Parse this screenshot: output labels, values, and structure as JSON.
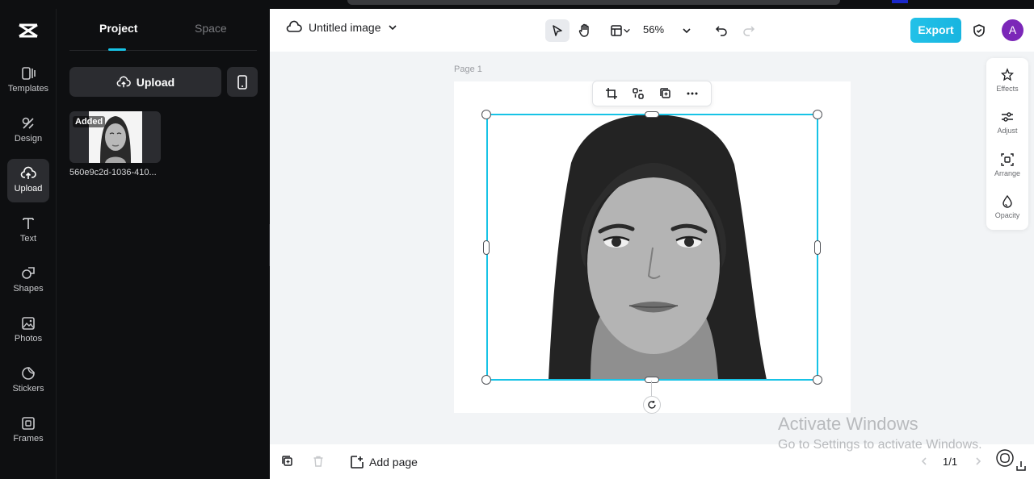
{
  "rail": {
    "items": [
      {
        "label": "Templates",
        "icon": "templates-icon"
      },
      {
        "label": "Design",
        "icon": "design-icon"
      },
      {
        "label": "Upload",
        "icon": "upload-cloud-icon"
      },
      {
        "label": "Text",
        "icon": "text-icon"
      },
      {
        "label": "Shapes",
        "icon": "shapes-icon"
      },
      {
        "label": "Photos",
        "icon": "photos-icon"
      },
      {
        "label": "Stickers",
        "icon": "stickers-icon"
      },
      {
        "label": "Frames",
        "icon": "frames-icon"
      }
    ],
    "active": "Upload"
  },
  "panel": {
    "tabs": [
      "Project",
      "Space"
    ],
    "active_tab": "Project",
    "upload_label": "Upload",
    "asset": {
      "badge": "Added",
      "filename": "560e9c2d-1036-410..."
    }
  },
  "topbar": {
    "doc_title": "Untitled image",
    "zoom": "56%",
    "export_label": "Export",
    "avatar_letter": "A"
  },
  "canvas": {
    "page_label": "Page 1"
  },
  "right_dock": {
    "items": [
      "Effects",
      "Adjust",
      "Arrange",
      "Opacity"
    ]
  },
  "bottombar": {
    "add_page_label": "Add page",
    "pager": "1/1"
  },
  "watermark": {
    "line1": "Activate Windows",
    "line2": "Go to Settings to activate Windows."
  },
  "colors": {
    "accent": "#17c3e6",
    "avatar": "#7b27b8",
    "rail_bg": "#0e0f11"
  }
}
